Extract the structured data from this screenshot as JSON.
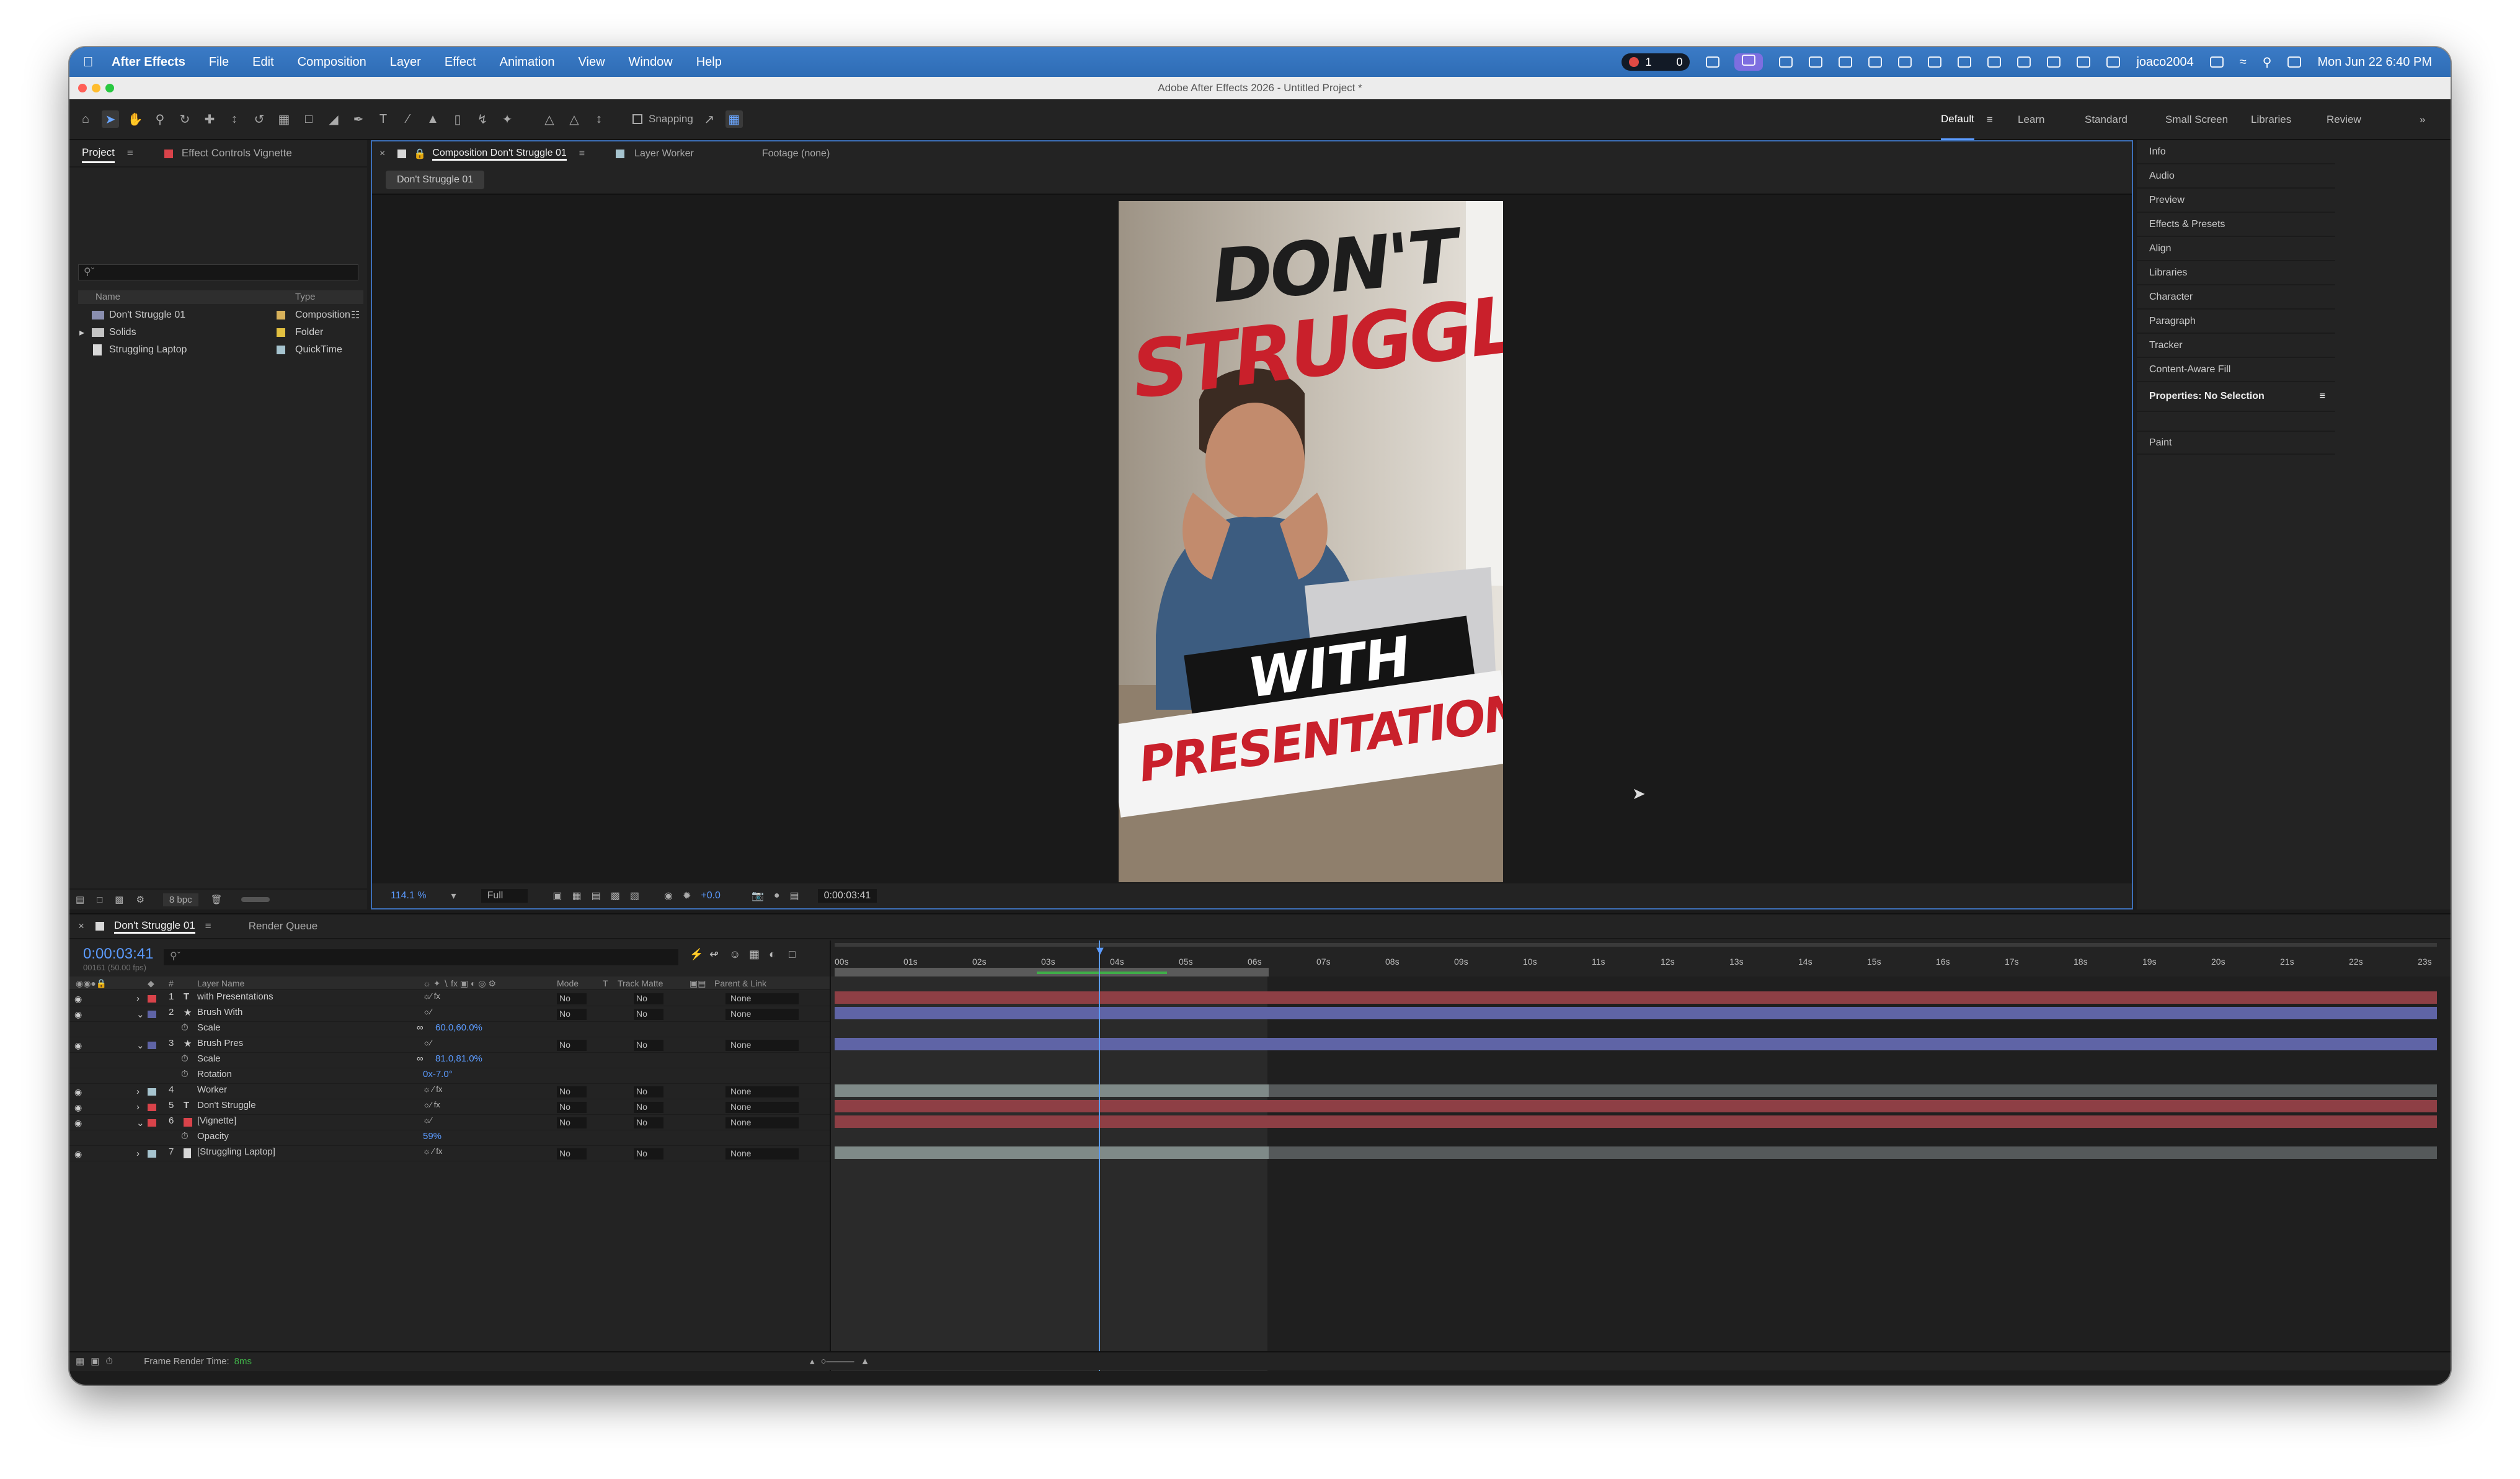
{
  "menubar": {
    "app": "After Effects",
    "items": [
      "File",
      "Edit",
      "Composition",
      "Layer",
      "Effect",
      "Animation",
      "View",
      "Window",
      "Help"
    ],
    "indicator_a": "1",
    "indicator_b": "0",
    "user": "joaco2004",
    "datetime": "Mon Jun 22  6:40 PM"
  },
  "window": {
    "title": "Adobe After Effects 2026 - Untitled Project *"
  },
  "toolbar": {
    "snapping": "Snapping",
    "workspaces": [
      "Default",
      "Learn",
      "Standard",
      "Small Screen",
      "Libraries",
      "Review"
    ],
    "more": "»"
  },
  "project": {
    "tab_project": "Project",
    "tab_effect_controls": "Effect Controls Vignette",
    "col_name": "Name",
    "col_type": "Type",
    "items": [
      {
        "name": "Don't Struggle 01",
        "type": "Composition"
      },
      {
        "name": "Solids",
        "type": "Folder"
      },
      {
        "name": "Struggling Laptop",
        "type": "QuickTime"
      }
    ],
    "bpc": "8 bpc"
  },
  "comp": {
    "tab_comp": "Composition Don't Struggle 01",
    "tab_layer": "Layer Worker",
    "tab_footage": "Footage (none)",
    "chip": "Don't Struggle 01",
    "zoom": "114.1 %",
    "resolution": "Full",
    "exposure": "+0.0",
    "timecode": "0:00:03:41"
  },
  "viewer": {
    "line1": "DON'T",
    "line2": "STRUGGLE",
    "line3": "WITH",
    "line4": "PRESENTATIONS"
  },
  "right_panel": {
    "items": [
      "Info",
      "Audio",
      "Preview",
      "Effects & Presets",
      "Align",
      "Libraries",
      "Character",
      "Paragraph",
      "Tracker",
      "Content-Aware Fill"
    ],
    "properties": "Properties: No Selection",
    "paint": "Paint"
  },
  "timeline": {
    "tab_comp": "Don't Struggle 01",
    "tab_render": "Render Queue",
    "timecode": "0:00:03:41",
    "subcode": "00161 (50.00 fps)",
    "columns": {
      "num": "#",
      "layer_name": "Layer Name",
      "mode": "Mode",
      "t": "T",
      "track_matte": "Track Matte",
      "parent": "Parent & Link"
    },
    "layers": [
      {
        "num": "1",
        "name": "with Presentations",
        "mode": "No",
        "tm": "No",
        "parent": "None"
      },
      {
        "num": "2",
        "name": "Brush With",
        "mode": "No",
        "tm": "No",
        "parent": "None"
      },
      {
        "prop": "Scale",
        "value": "60.0,60.0%"
      },
      {
        "num": "3",
        "name": "Brush Pres",
        "mode": "No",
        "tm": "No",
        "parent": "None"
      },
      {
        "prop": "Scale",
        "value": "81.0,81.0%"
      },
      {
        "prop": "Rotation",
        "value": "0x-7.0°"
      },
      {
        "num": "4",
        "name": "Worker",
        "mode": "No",
        "tm": "No",
        "parent": "None"
      },
      {
        "num": "5",
        "name": "Don't Struggle",
        "mode": "No",
        "tm": "No",
        "parent": "None"
      },
      {
        "num": "6",
        "name": "[Vignette]",
        "mode": "No",
        "tm": "No",
        "parent": "None"
      },
      {
        "prop": "Opacity",
        "value": "59%"
      },
      {
        "num": "7",
        "name": "[Struggling Laptop]",
        "mode": "No",
        "tm": "No",
        "parent": "None"
      }
    ],
    "ruler": [
      "00s",
      "01s",
      "02s",
      "03s",
      "04s",
      "05s",
      "06s",
      "07s",
      "08s",
      "09s",
      "10s",
      "11s",
      "12s",
      "13s",
      "14s",
      "15s",
      "16s",
      "17s",
      "18s",
      "19s",
      "20s",
      "21s",
      "22s",
      "23s"
    ],
    "frame_render": "Frame Render Time:",
    "frame_render_value": "8ms"
  },
  "colors": {
    "accent": "#5b9bff",
    "layer_red": "#8e3f45",
    "layer_purple": "#5f64a6",
    "layer_gray": "#7f8a88",
    "brand_red": "#c9202b"
  }
}
